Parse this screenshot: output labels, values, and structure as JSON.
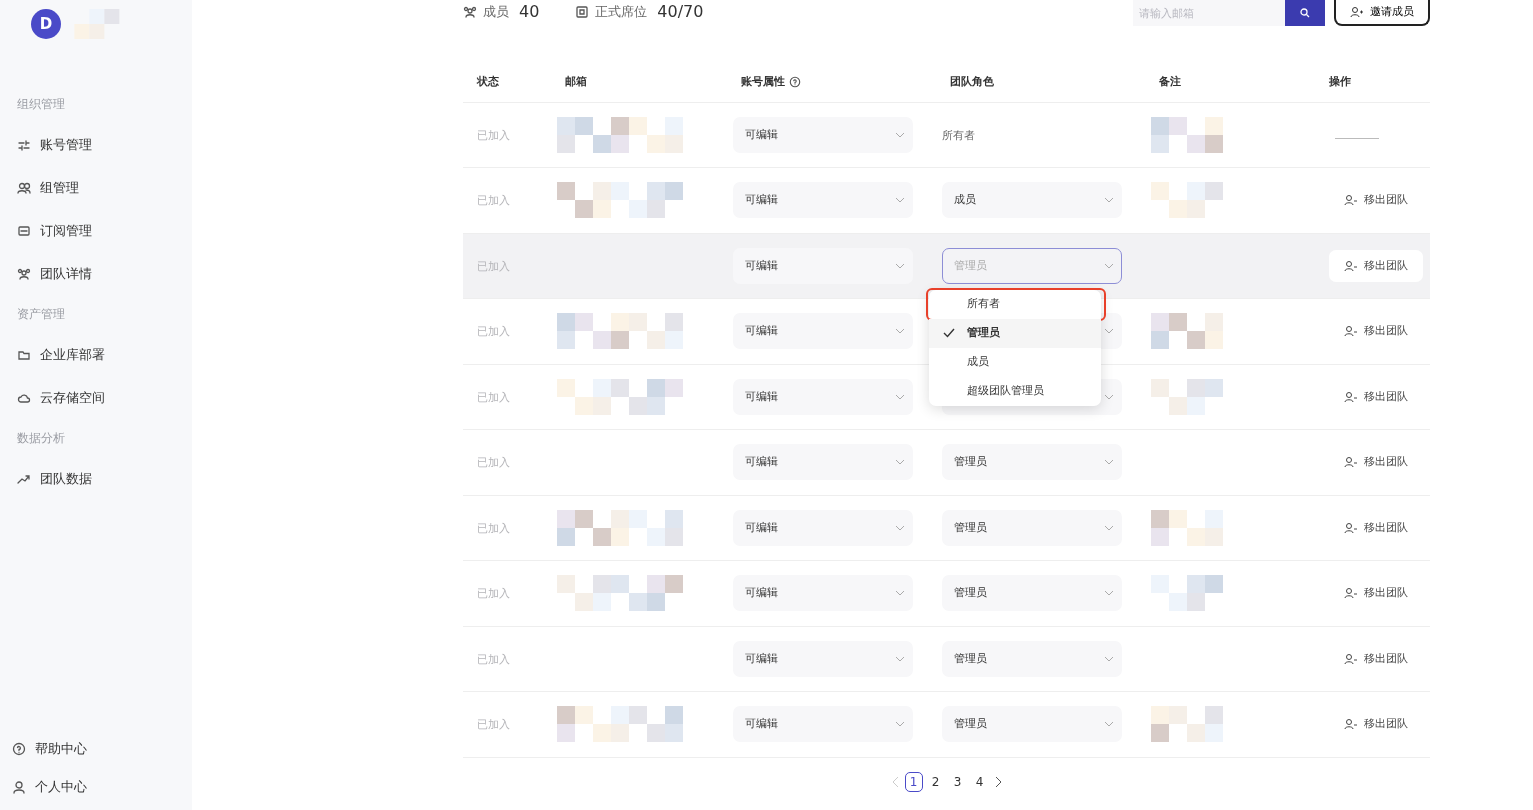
{
  "sidebar": {
    "avatar_letter": "D",
    "sections": [
      {
        "title": "组织管理",
        "items": [
          {
            "label": "账号管理"
          },
          {
            "label": "组管理"
          },
          {
            "label": "订阅管理"
          },
          {
            "label": "团队详情"
          }
        ]
      },
      {
        "title": "资产管理",
        "items": [
          {
            "label": "企业库部署"
          },
          {
            "label": "云存储空间"
          }
        ]
      },
      {
        "title": "数据分析",
        "items": [
          {
            "label": "团队数据"
          }
        ]
      }
    ],
    "footer": [
      {
        "label": "帮助中心"
      },
      {
        "label": "个人中心"
      }
    ]
  },
  "stats": [
    {
      "label": "成员",
      "value": "40"
    },
    {
      "label": "正式席位",
      "value": "40/70"
    }
  ],
  "search": {
    "placeholder": "请输入邮箱"
  },
  "invite_button": "邀请成员",
  "table": {
    "columns": [
      "状态",
      "邮箱",
      "账号属性",
      "团队角色",
      "备注",
      "操作"
    ],
    "rows": [
      {
        "status": "已加入",
        "has_email": true,
        "account": "可编辑",
        "role": {
          "kind": "text",
          "value": "所有者"
        },
        "has_note": true,
        "action": {
          "kind": "none"
        },
        "hovered": false
      },
      {
        "status": "已加入",
        "has_email": true,
        "account": "可编辑",
        "role": {
          "kind": "select",
          "value": "成员"
        },
        "has_note": true,
        "action": {
          "kind": "button",
          "label": "移出团队"
        },
        "hovered": false
      },
      {
        "status": "已加入",
        "has_email": false,
        "account": "可编辑",
        "role": {
          "kind": "select",
          "placeholder": "管理员",
          "open": true
        },
        "has_note": false,
        "action": {
          "kind": "button",
          "label": "移出团队"
        },
        "hovered": true
      },
      {
        "status": "已加入",
        "has_email": true,
        "account": "可编辑",
        "role": {
          "kind": "select"
        },
        "has_note": true,
        "action": {
          "kind": "button",
          "label": "移出团队"
        },
        "hovered": false
      },
      {
        "status": "已加入",
        "has_email": true,
        "account": "可编辑",
        "role": {
          "kind": "select"
        },
        "has_note": true,
        "action": {
          "kind": "button",
          "label": "移出团队"
        },
        "hovered": false
      },
      {
        "status": "已加入",
        "has_email": false,
        "account": "可编辑",
        "role": {
          "kind": "select",
          "value": "管理员"
        },
        "has_note": false,
        "action": {
          "kind": "button",
          "label": "移出团队"
        },
        "hovered": false
      },
      {
        "status": "已加入",
        "has_email": true,
        "account": "可编辑",
        "role": {
          "kind": "select",
          "value": "管理员"
        },
        "has_note": true,
        "action": {
          "kind": "button",
          "label": "移出团队"
        },
        "hovered": false
      },
      {
        "status": "已加入",
        "has_email": true,
        "account": "可编辑",
        "role": {
          "kind": "select",
          "value": "管理员"
        },
        "has_note": true,
        "action": {
          "kind": "button",
          "label": "移出团队"
        },
        "hovered": false
      },
      {
        "status": "已加入",
        "has_email": false,
        "account": "可编辑",
        "role": {
          "kind": "select",
          "value": "管理员"
        },
        "has_note": false,
        "action": {
          "kind": "button",
          "label": "移出团队"
        },
        "hovered": false
      },
      {
        "status": "已加入",
        "has_email": true,
        "account": "可编辑",
        "role": {
          "kind": "select",
          "value": "管理员"
        },
        "has_note": true,
        "action": {
          "kind": "button",
          "label": "移出团队"
        },
        "hovered": false
      }
    ]
  },
  "role_menu": [
    {
      "label": "所有者",
      "selected": false,
      "highlighted": true
    },
    {
      "label": "管理员",
      "selected": true,
      "highlighted": false
    },
    {
      "label": "成员",
      "selected": false,
      "highlighted": false
    },
    {
      "label": "超级团队管理员",
      "selected": false,
      "highlighted": false
    }
  ],
  "pagination": {
    "pages": [
      {
        "label": "1",
        "selected": true
      },
      {
        "label": "2",
        "selected": false
      },
      {
        "label": "3",
        "selected": false
      },
      {
        "label": "4",
        "selected": false
      }
    ]
  }
}
